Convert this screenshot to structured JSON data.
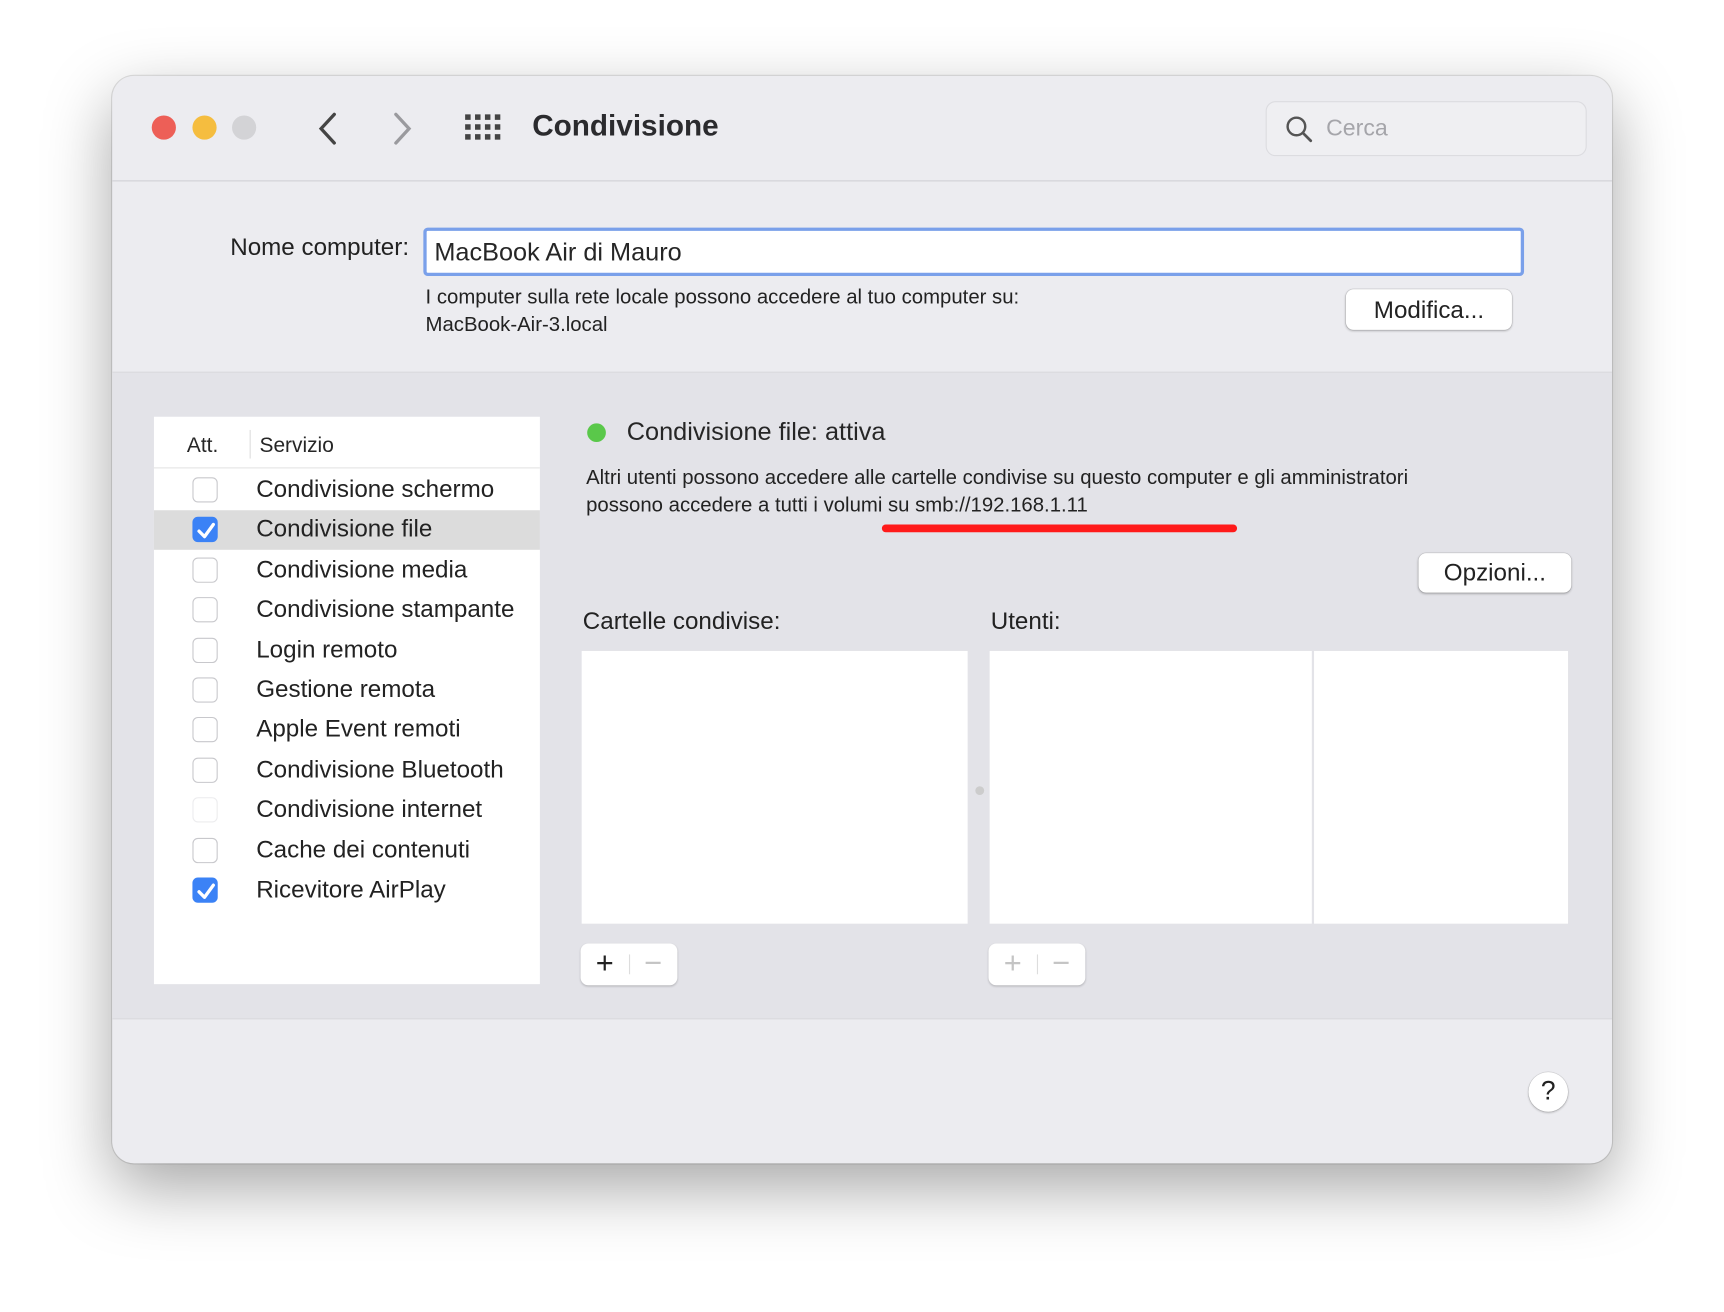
{
  "window": {
    "title": "Condivisione"
  },
  "search": {
    "placeholder": "Cerca"
  },
  "computer_name": {
    "label": "Nome computer:",
    "value": "MacBook Air di Mauro",
    "info_line1": "I computer sulla rete locale possono accedere al tuo computer su:",
    "info_line2": "MacBook-Air-3.local",
    "edit_button": "Modifica..."
  },
  "services": {
    "header_on": "Att.",
    "header_service": "Servizio",
    "items": [
      {
        "label": "Condivisione schermo",
        "checked": false
      },
      {
        "label": "Condivisione file",
        "checked": true,
        "selected": true
      },
      {
        "label": "Condivisione media",
        "checked": false
      },
      {
        "label": "Condivisione stampante",
        "checked": false
      },
      {
        "label": "Login remoto",
        "checked": false
      },
      {
        "label": "Gestione remota",
        "checked": false
      },
      {
        "label": "Apple Event remoti",
        "checked": false
      },
      {
        "label": "Condivisione Bluetooth",
        "checked": false
      },
      {
        "label": "Condivisione internet",
        "checked": false,
        "disabled": true
      },
      {
        "label": "Cache dei contenuti",
        "checked": false
      },
      {
        "label": "Ricevitore AirPlay",
        "checked": true
      }
    ]
  },
  "detail": {
    "status": "Condivisione file: attiva",
    "status_color": "#5ac84a",
    "description_line1": "Altri utenti possono accedere alle cartelle condivise su questo computer e gli amministratori",
    "description_line2": "possono accedere a tutti i volumi su smb://192.168.1.11",
    "options_button": "Opzioni...",
    "shared_folders_label": "Cartelle condivise:",
    "users_label": "Utenti:",
    "add": "+",
    "remove": "−"
  },
  "help": "?",
  "annotation_color": "#ff1a1a"
}
